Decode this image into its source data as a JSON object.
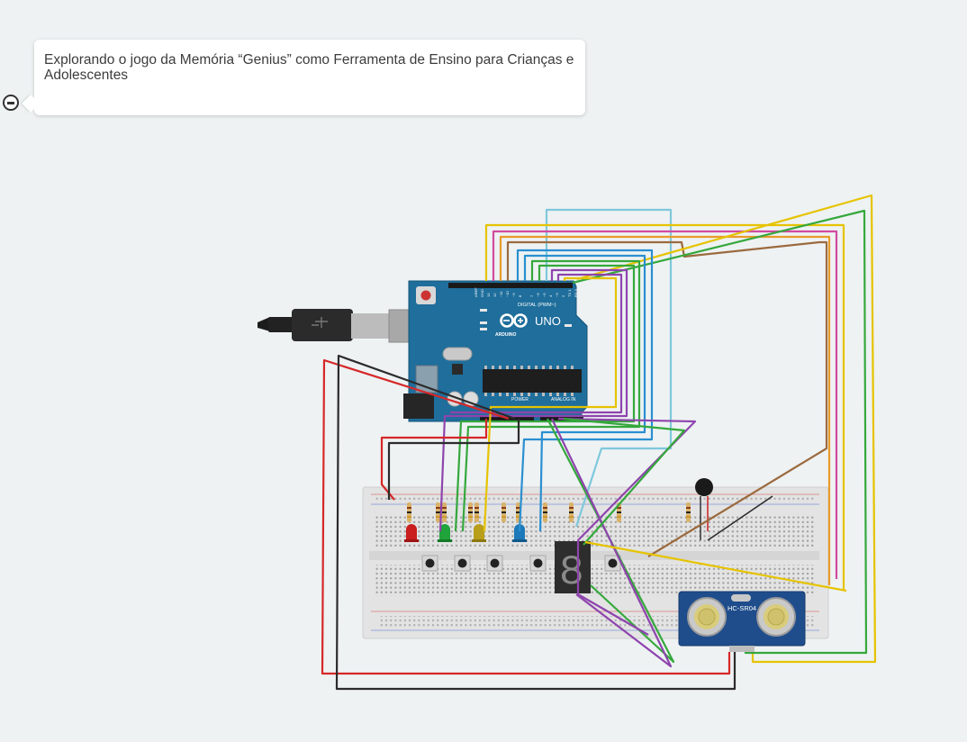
{
  "note": {
    "text": "Explorando o jogo da Memória “Genius” como Ferramenta de Ensino para Crianças e Adolescentes",
    "collapse_icon": "minus-circle-icon"
  },
  "arduino": {
    "board_label": "UNO",
    "brand": "ARDUINO",
    "digital_header": "DIGITAL (PWM~)",
    "power_label": "POWER",
    "analog_label": "ANALOG IN"
  },
  "sensor": {
    "label": "HC-SR04"
  },
  "display": {
    "digit": "8"
  },
  "colors": {
    "background": "#eef2f3",
    "board_blue": "#1f6e9c",
    "wire_red": "#d62828",
    "wire_black": "#2b2b2b",
    "wire_yellow": "#e6c300",
    "wire_green": "#35a83c",
    "wire_purple": "#8e44ad",
    "wire_blue": "#2a8fd0",
    "wire_lightblue": "#7fc8dc",
    "wire_pink": "#d14aa0",
    "wire_orange": "#e89a2a",
    "wire_brown": "#9b6a3e"
  },
  "leds": [
    {
      "color": "#c81e1e"
    },
    {
      "color": "#1fa33a"
    },
    {
      "color": "#b89e1a"
    },
    {
      "color": "#1c78b8"
    }
  ]
}
